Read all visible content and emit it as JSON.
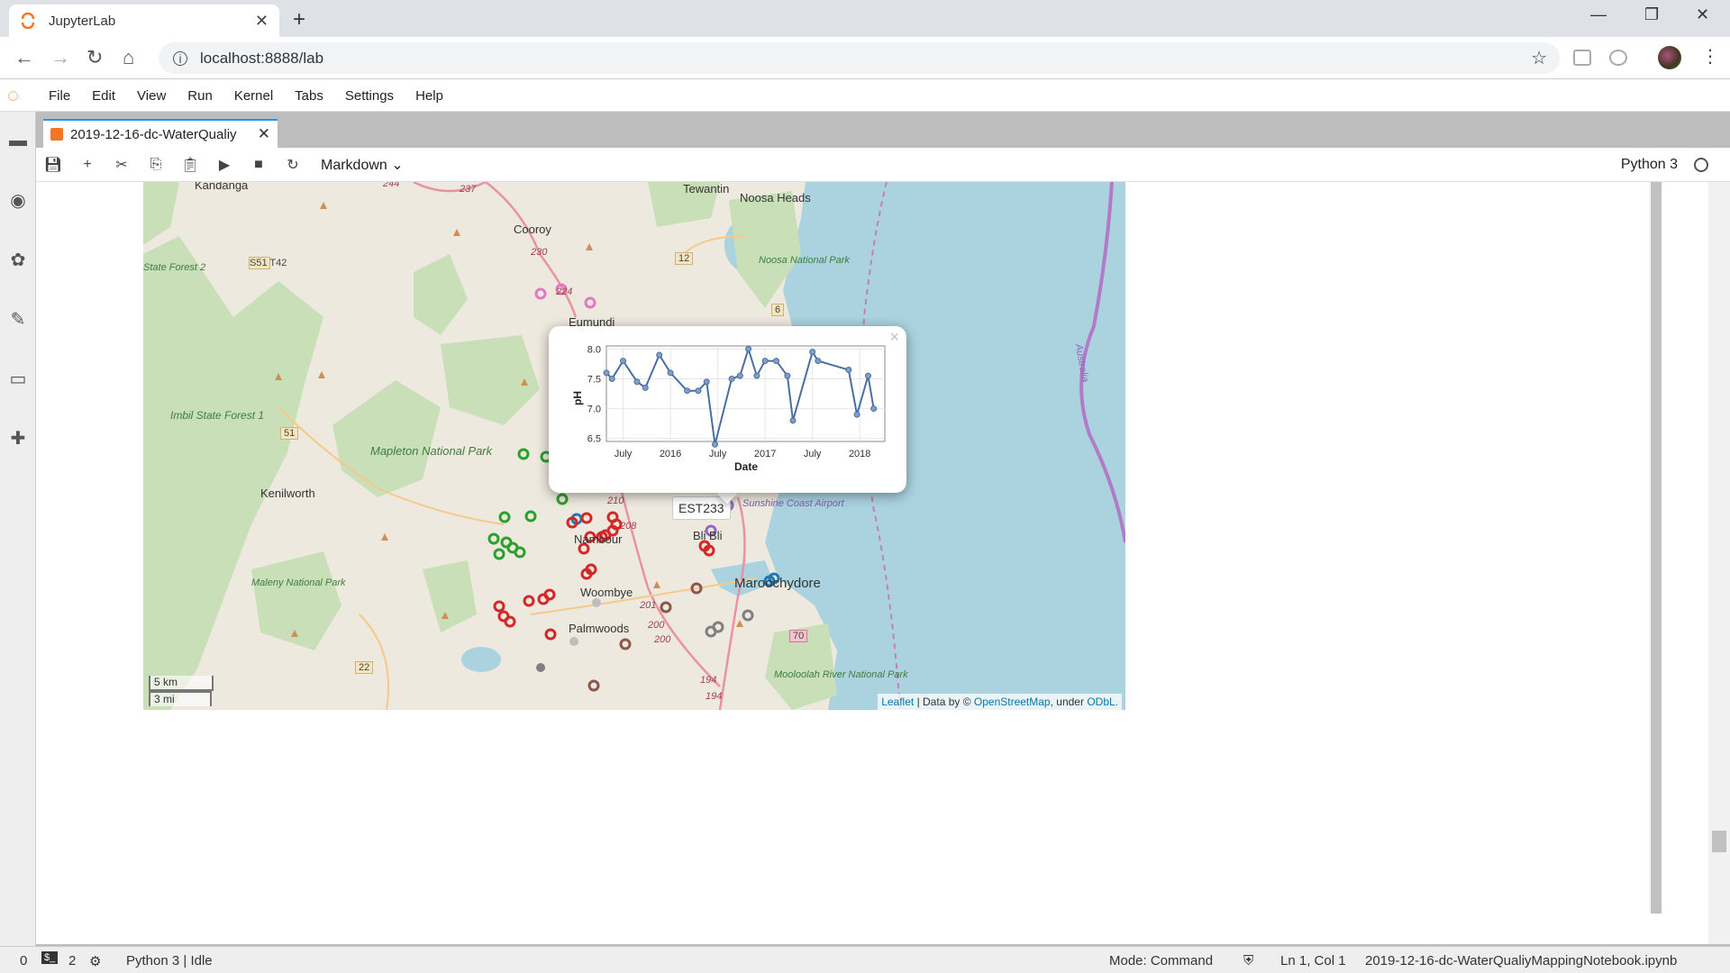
{
  "browser": {
    "tab_title": "JupyterLab",
    "url": "localhost:8888/lab"
  },
  "menu": [
    "File",
    "Edit",
    "View",
    "Run",
    "Kernel",
    "Tabs",
    "Settings",
    "Help"
  ],
  "document": {
    "tab_label": "2019-12-16-dc-WaterQualiy",
    "cell_type": "Markdown",
    "kernel": "Python 3"
  },
  "map": {
    "towns": [
      {
        "name": "Kandanga"
      },
      {
        "name": "Tewantin"
      },
      {
        "name": "Noosa Heads"
      },
      {
        "name": "Cooroy"
      },
      {
        "name": "Eumundi"
      },
      {
        "name": "Kenilworth"
      },
      {
        "name": "Nambour"
      },
      {
        "name": "Bli Bli"
      },
      {
        "name": "Woombye"
      },
      {
        "name": "Palmwoods"
      },
      {
        "name": "Maroochydore"
      }
    ],
    "parks": [
      "Imbil State Forest 1",
      "Mapleton National Park",
      "Maleny National Park",
      "Noosa National Park",
      "Mooloolah River National Park",
      "State Forest 2"
    ],
    "road_shields": [
      "S51 T42",
      "12",
      "6",
      "51",
      "22",
      "70"
    ],
    "road_numbers": [
      "244",
      "237",
      "230",
      "224",
      "210",
      "208",
      "201",
      "200",
      "200",
      "194",
      "194"
    ],
    "other_labels": [
      "Sunshine Coast Airport",
      "Australia"
    ],
    "scale": {
      "km": "5 km",
      "mi": "3 mi"
    },
    "attribution": {
      "leaflet": "Leaflet",
      "sep": " | Data by © ",
      "osm": "OpenStreetMap",
      "under": ", under ",
      "odbl": "ODbL."
    },
    "tooltip": "EST233"
  },
  "chart_data": {
    "type": "line",
    "title": "",
    "xlabel": "Date",
    "ylabel": "pH",
    "ylim": [
      6.45,
      8.05
    ],
    "yticks": [
      6.5,
      7.0,
      7.5,
      8.0
    ],
    "ytick_labels": [
      "6.5",
      "7.0",
      "7.5",
      "8.0"
    ],
    "xtick_labels": [
      "July",
      "2016",
      "July",
      "2017",
      "July",
      "2018"
    ],
    "xtick_positions": [
      0.06,
      0.23,
      0.4,
      0.57,
      0.74,
      0.91
    ],
    "series": [
      {
        "x": [
          0.0,
          0.02,
          0.06,
          0.11,
          0.14,
          0.19,
          0.23,
          0.29,
          0.33,
          0.36,
          0.39,
          0.45,
          0.48,
          0.51,
          0.54,
          0.57,
          0.61,
          0.65,
          0.67,
          0.74,
          0.76,
          0.87,
          0.9,
          0.94,
          0.96
        ],
        "values": [
          7.6,
          7.5,
          7.8,
          7.45,
          7.35,
          7.9,
          7.6,
          7.3,
          7.3,
          7.45,
          6.4,
          7.5,
          7.55,
          8.0,
          7.55,
          7.8,
          7.8,
          7.55,
          6.8,
          7.95,
          7.8,
          7.65,
          6.9,
          7.55,
          7.0
        ]
      }
    ],
    "color": "#4a6f9f"
  },
  "statusbar": {
    "zero": "0",
    "terminals": "2",
    "kernel_status": "Python 3 | Idle",
    "mode": "Mode: Command",
    "cursor": "Ln 1, Col 1",
    "filename": "2019-12-16-dc-WaterQualiyMappingNotebook.ipynb"
  },
  "colors": {
    "land": "#eee9df",
    "water": "#aad3df",
    "forest": "#c8dfb8",
    "accent": "#2196f3",
    "jupyter_orange": "#f37626"
  }
}
